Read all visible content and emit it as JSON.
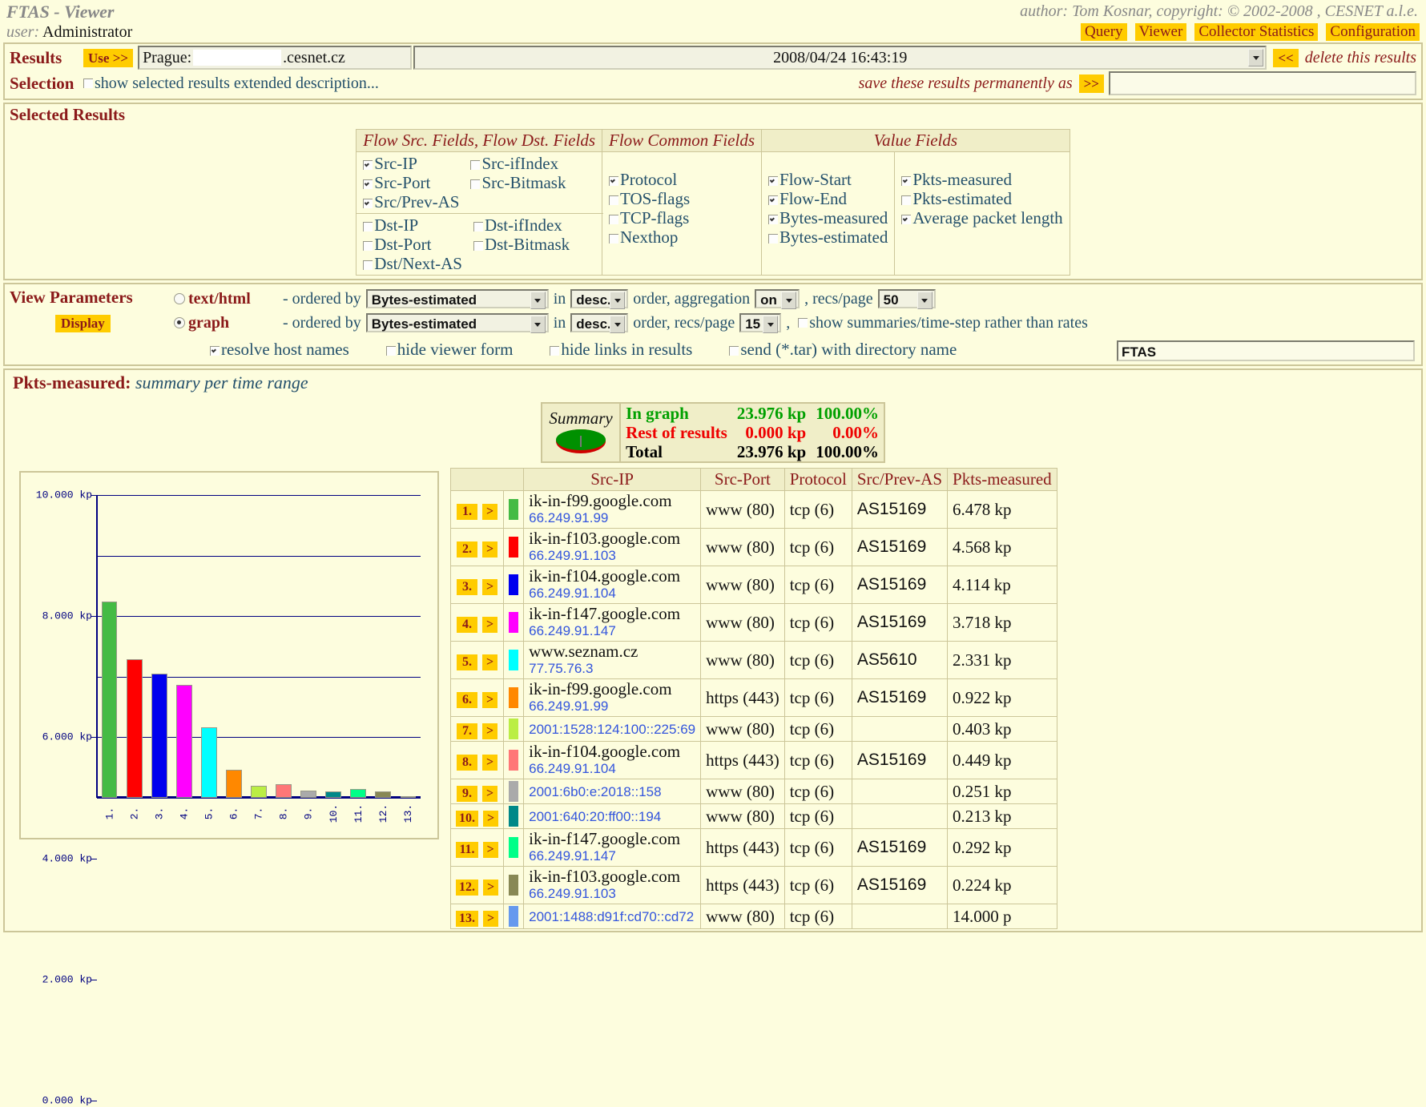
{
  "header": {
    "title": "FTAS - Viewer",
    "user_label": "user:",
    "user_name": "Administrator",
    "author": "author: Tom Kosnar, copyright: © 2002-2008 , CESNET a.l.e.",
    "nav": [
      "Query",
      "Viewer",
      "Collector Statistics",
      "Configuration"
    ]
  },
  "results": {
    "label_results": "Results",
    "label_selection": "Selection",
    "use_button": "Use >>",
    "host_prefix": "Prague:",
    "host_suffix": ".cesnet.cz",
    "timestamp": "2008/04/24 16:43:19",
    "back_button": "<<",
    "delete_text": "delete this results",
    "show_extended": "show selected results extended description...",
    "save_text": "save these results permanently as",
    "save_button": ">>",
    "save_value": ""
  },
  "selected_results": {
    "title": "Selected Results",
    "columns": {
      "src_dst": "Flow Src. Fields, Flow Dst. Fields",
      "common": "Flow Common Fields",
      "value": "Value Fields"
    },
    "src_fields": [
      {
        "label": "Src-IP",
        "checked": true
      },
      {
        "label": "Src-Port",
        "checked": true
      },
      {
        "label": "Src/Prev-AS",
        "checked": true
      }
    ],
    "src_fields2": [
      {
        "label": "Src-ifIndex",
        "checked": false
      },
      {
        "label": "Src-Bitmask",
        "checked": false
      }
    ],
    "dst_fields": [
      {
        "label": "Dst-IP",
        "checked": false
      },
      {
        "label": "Dst-Port",
        "checked": false
      },
      {
        "label": "Dst/Next-AS",
        "checked": false
      }
    ],
    "dst_fields2": [
      {
        "label": "Dst-ifIndex",
        "checked": false
      },
      {
        "label": "Dst-Bitmask",
        "checked": false
      }
    ],
    "common_fields": [
      {
        "label": "Protocol",
        "checked": true
      },
      {
        "label": "TOS-flags",
        "checked": false
      },
      {
        "label": "TCP-flags",
        "checked": false
      },
      {
        "label": "Nexthop",
        "checked": false
      }
    ],
    "value_fields1": [
      {
        "label": "Flow-Start",
        "checked": true
      },
      {
        "label": "Flow-End",
        "checked": true
      },
      {
        "label": "Bytes-measured",
        "checked": true
      },
      {
        "label": "Bytes-estimated",
        "checked": false
      }
    ],
    "value_fields2": [
      {
        "label": "Pkts-measured",
        "checked": true
      },
      {
        "label": "Pkts-estimated",
        "checked": false
      },
      {
        "label": "Average packet length",
        "checked": true
      }
    ]
  },
  "view_parameters": {
    "title": "View Parameters",
    "display_button": "Display",
    "text_html": {
      "mode_label": "text/html",
      "selected": false,
      "ordered_by_label": "- ordered by",
      "order_field": "Bytes-estimated",
      "in_label": "in",
      "direction": "desc.",
      "order_label": "order, aggregation",
      "aggregation": "on",
      "recs_label": ", recs/page",
      "recs_per_page": "50"
    },
    "graph": {
      "mode_label": "graph",
      "selected": true,
      "ordered_by_label": "- ordered by",
      "order_field": "Bytes-estimated",
      "in_label": "in",
      "direction": "desc.",
      "order_label": "order, recs/page",
      "recs_per_page": "15",
      "comma": ",",
      "summaries_label": "show summaries/time-step rather than rates",
      "summaries_checked": false
    },
    "checks": [
      {
        "label": "resolve host names",
        "checked": true
      },
      {
        "label": "hide viewer form",
        "checked": false
      },
      {
        "label": "hide links in results",
        "checked": false
      },
      {
        "label": "send (*.tar) with directory name",
        "checked": false
      }
    ],
    "directory_name": "FTAS"
  },
  "results_view": {
    "heading_metric": "Pkts-measured:",
    "heading_sub": "summary per time range",
    "summary": {
      "caption": "Summary",
      "rows": [
        {
          "label": "In graph",
          "value": "23.976 kp",
          "percent": "100.00%",
          "color": "#00a000"
        },
        {
          "label": "Rest of results",
          "value": "0.000 kp",
          "percent": "0.00%",
          "color": "#ee0000"
        },
        {
          "label": "Total",
          "value": "23.976 kp",
          "percent": "100.00%",
          "color": "#000000"
        }
      ]
    },
    "table": {
      "headers": [
        "",
        "",
        "Src-IP",
        "Src-Port",
        "Protocol",
        "Src/Prev-AS",
        "Pkts-measured"
      ],
      "arrow_label": ">",
      "rows": [
        {
          "index": "1.",
          "color": "#44bb44",
          "host": "ik-in-f99.google.com",
          "ip": "66.249.91.99",
          "port": "www (80)",
          "protocol": "tcp (6)",
          "as": "AS15169",
          "pkts": "6.478 kp"
        },
        {
          "index": "2.",
          "color": "#ff0000",
          "host": "ik-in-f103.google.com",
          "ip": "66.249.91.103",
          "port": "www (80)",
          "protocol": "tcp (6)",
          "as": "AS15169",
          "pkts": "4.568 kp"
        },
        {
          "index": "3.",
          "color": "#0000ee",
          "host": "ik-in-f104.google.com",
          "ip": "66.249.91.104",
          "port": "www (80)",
          "protocol": "tcp (6)",
          "as": "AS15169",
          "pkts": "4.114 kp"
        },
        {
          "index": "4.",
          "color": "#ff00ff",
          "host": "ik-in-f147.google.com",
          "ip": "66.249.91.147",
          "port": "www (80)",
          "protocol": "tcp (6)",
          "as": "AS15169",
          "pkts": "3.718 kp"
        },
        {
          "index": "5.",
          "color": "#00ffff",
          "host": "www.seznam.cz",
          "ip": "77.75.76.3",
          "port": "www (80)",
          "protocol": "tcp (6)",
          "as": "AS5610",
          "pkts": "2.331 kp"
        },
        {
          "index": "6.",
          "color": "#ff8800",
          "host": "ik-in-f99.google.com",
          "ip": "66.249.91.99",
          "port": "https (443)",
          "protocol": "tcp (6)",
          "as": "AS15169",
          "pkts": "0.922 kp"
        },
        {
          "index": "7.",
          "color": "#bbee44",
          "host": "",
          "ip": "2001:1528:124:100::225:69",
          "port": "www (80)",
          "protocol": "tcp (6)",
          "as": "",
          "pkts": "0.403 kp"
        },
        {
          "index": "8.",
          "color": "#ff7777",
          "host": "ik-in-f104.google.com",
          "ip": "66.249.91.104",
          "port": "https (443)",
          "protocol": "tcp (6)",
          "as": "AS15169",
          "pkts": "0.449 kp"
        },
        {
          "index": "9.",
          "color": "#aaaaaa",
          "host": "",
          "ip": "2001:6b0:e:2018::158",
          "port": "www (80)",
          "protocol": "tcp (6)",
          "as": "",
          "pkts": "0.251 kp"
        },
        {
          "index": "10.",
          "color": "#008888",
          "host": "",
          "ip": "2001:640:20:ff00::194",
          "port": "www (80)",
          "protocol": "tcp (6)",
          "as": "",
          "pkts": "0.213 kp"
        },
        {
          "index": "11.",
          "color": "#00ff88",
          "host": "ik-in-f147.google.com",
          "ip": "66.249.91.147",
          "port": "https (443)",
          "protocol": "tcp (6)",
          "as": "AS15169",
          "pkts": "0.292 kp"
        },
        {
          "index": "12.",
          "color": "#888855",
          "host": "ik-in-f103.google.com",
          "ip": "66.249.91.103",
          "port": "https (443)",
          "protocol": "tcp (6)",
          "as": "AS15169",
          "pkts": "0.224 kp"
        },
        {
          "index": "13.",
          "color": "#6699ee",
          "host": "",
          "ip": "2001:1488:d91f:cd70::cd72",
          "port": "www (80)",
          "protocol": "tcp (6)",
          "as": "",
          "pkts": "14.000 p"
        }
      ]
    }
  },
  "chart_data": {
    "type": "bar",
    "title": "Pkts-measured: summary per time range",
    "xlabel": "",
    "ylabel": "kp",
    "ylim": [
      0,
      10
    ],
    "grid": true,
    "legend": "none",
    "ytick_labels": [
      "10.000 kp",
      "8.000 kp",
      "6.000 kp",
      "4.000 kp",
      "2.000 kp",
      "0.000 kp"
    ],
    "ytick_values": [
      10,
      8,
      6,
      4,
      2,
      0
    ],
    "categories": [
      "1.",
      "2.",
      "3.",
      "4.",
      "5.",
      "6.",
      "7.",
      "8.",
      "9.",
      "10.",
      "11.",
      "12.",
      "13."
    ],
    "values": [
      6.478,
      4.568,
      4.114,
      3.718,
      2.331,
      0.922,
      0.403,
      0.449,
      0.251,
      0.213,
      0.292,
      0.224,
      0.014
    ],
    "colors": [
      "#44bb44",
      "#ff0000",
      "#0000ee",
      "#ff00ff",
      "#00ffff",
      "#ff8800",
      "#bbee44",
      "#ff7777",
      "#aaaaaa",
      "#008888",
      "#00ff88",
      "#888855",
      "#6699ee"
    ]
  }
}
